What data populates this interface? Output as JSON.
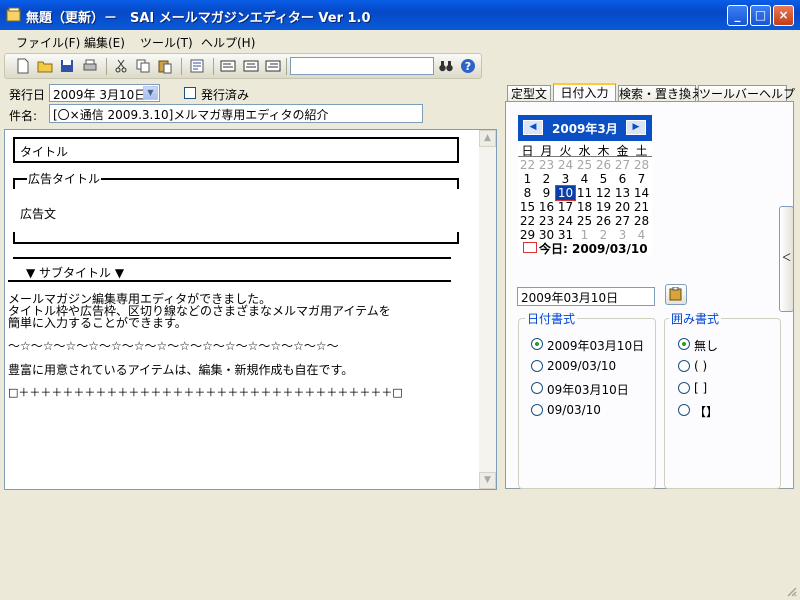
{
  "window": {
    "title": "無題（更新）－　SAI メールマガジンエディター Ver 1.0",
    "minimize_label": "_",
    "maximize_label": "□",
    "close_label": "×"
  },
  "menu": {
    "file": "ファイル(F)",
    "edit": "編集(E)",
    "tool": "ツール(T)",
    "help": "ヘルプ(H)"
  },
  "form": {
    "issue_date_label": "発行日",
    "issue_date_value": "2009年 3月10日",
    "issued_label": "発行済み",
    "subject_label": "件名:",
    "subject_value": "[〇×通信 2009.3.10]メルマガ専用エディタの紹介"
  },
  "editor": {
    "title_box": "タイトル",
    "ad_title": "広告タイトル",
    "ad_body": "広告文",
    "subtitle": "▼ サブタイトル ▼",
    "line1": "メールマガジン編集専用エディタができました。",
    "line2": "タイトル枠や広告枠、区切り線などのさまざまなメルマガ用アイテムを",
    "line3": "簡単に入力することができます。",
    "separator1": "～☆～☆～☆～☆～☆～☆～☆～☆～☆～☆～☆～☆～☆～☆～",
    "line4": "豊富に用意されているアイテムは、編集・新規作成も自在です。",
    "separator2": "□＋＋＋＋＋＋＋＋＋＋＋＋＋＋＋＋＋＋＋＋＋＋＋＋＋＋＋＋＋＋＋＋＋＋□",
    "scroll_up": "▲",
    "scroll_down": "▼"
  },
  "tabs": [
    {
      "label": "定型文"
    },
    {
      "label": "日付入力"
    },
    {
      "label": "検索・置き換え"
    },
    {
      "label": "ツールバーヘルプ"
    }
  ],
  "calendar": {
    "month_label": "2009年3月",
    "prev": "◀",
    "next": "▶",
    "weekdays": [
      "日",
      "月",
      "火",
      "水",
      "木",
      "金",
      "土"
    ],
    "weeks": [
      [
        "22",
        "23",
        "24",
        "25",
        "26",
        "27",
        "28"
      ],
      [
        "1",
        "2",
        "3",
        "4",
        "5",
        "6",
        "7"
      ],
      [
        "8",
        "9",
        "10",
        "11",
        "12",
        "13",
        "14"
      ],
      [
        "15",
        "16",
        "17",
        "18",
        "19",
        "20",
        "21"
      ],
      [
        "22",
        "23",
        "24",
        "25",
        "26",
        "27",
        "28"
      ],
      [
        "29",
        "30",
        "31",
        "1",
        "2",
        "3",
        "4"
      ]
    ],
    "today_label": "今日: 2009/03/10"
  },
  "date_output": {
    "value": "2009年03月10日"
  },
  "date_format": {
    "title": "日付書式",
    "options": [
      "2009年03月10日",
      "2009/03/10",
      "09年03月10日",
      "09/03/10"
    ],
    "selected": 0
  },
  "enclosure_format": {
    "title": "囲み書式",
    "options": [
      "無し",
      "( )",
      "[ ]",
      "【】"
    ],
    "selected": 0
  },
  "side_toggle": "＜",
  "colors": {
    "titlebar": "#0548c6",
    "calendar_header": "#0a50c4",
    "group_title": "#0046d5"
  }
}
